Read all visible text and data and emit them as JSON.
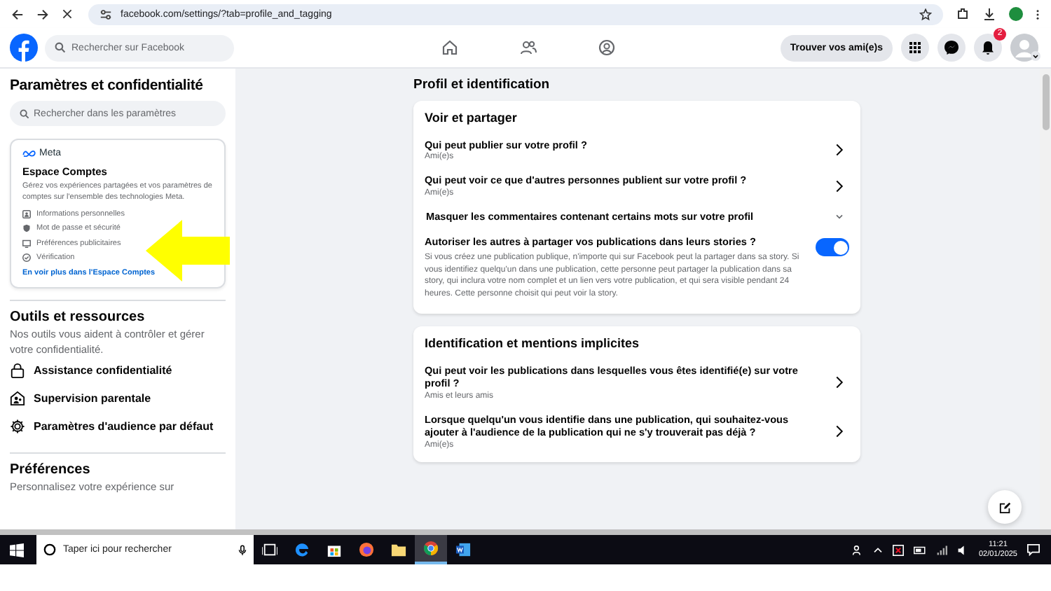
{
  "browser": {
    "url": "facebook.com/settings/?tab=profile_and_tagging"
  },
  "header": {
    "search_placeholder": "Rechercher sur Facebook",
    "find_friends": "Trouver vos ami(e)s",
    "notification_badge": "2"
  },
  "sidebar": {
    "title": "Paramètres et confidentialité",
    "search_placeholder": "Rechercher dans les paramètres",
    "accounts_center": {
      "brand": "Meta",
      "title": "Espace Comptes",
      "description": "Gérez vos expériences partagées et vos paramètres de comptes sur l'ensemble des technologies Meta.",
      "items": [
        {
          "kind": "person",
          "label": "Informations personnelles"
        },
        {
          "kind": "shield",
          "label": "Mot de passe et sécurité"
        },
        {
          "kind": "screen",
          "label": "Préférences publicitaires"
        },
        {
          "kind": "check",
          "label": "Vérification"
        }
      ],
      "link": "En voir plus dans l'Espace Comptes"
    },
    "tools": {
      "title": "Outils et ressources",
      "description": "Nos outils vous aident à contrôler et gérer votre confidentialité.",
      "items": [
        {
          "kind": "lock",
          "label": "Assistance confidentialité"
        },
        {
          "kind": "family",
          "label": "Supervision parentale"
        },
        {
          "kind": "gear",
          "label": "Paramètres d'audience par défaut"
        }
      ]
    },
    "preferences": {
      "title": "Préférences",
      "description": "Personnalisez votre expérience sur"
    }
  },
  "main": {
    "title": "Profil et identification",
    "sections": [
      {
        "title": "Voir et partager",
        "rows": [
          {
            "kind": "link",
            "label": "Qui peut publier sur votre profil ?",
            "value": "Ami(e)s"
          },
          {
            "kind": "link",
            "label": "Qui peut voir ce que d'autres personnes publient sur votre profil ?",
            "value": "Ami(e)s"
          },
          {
            "kind": "expand",
            "label": "Masquer les commentaires contenant certains mots sur votre profil",
            "expanded": false
          },
          {
            "kind": "toggle",
            "label": "Autoriser les autres à partager vos publications dans leurs stories ?",
            "description": "Si vous créez une publication publique, n'importe qui sur Facebook peut la partager dans sa story. Si vous identifiez quelqu'un dans une publication, cette personne peut partager la publication dans sa story, qui inclura votre nom complet et un lien vers votre publication, et qui sera visible pendant 24 heures. Cette personne choisit qui peut voir la story.",
            "on": true
          }
        ]
      },
      {
        "title": "Identification et mentions implicites",
        "rows": [
          {
            "kind": "link",
            "label": "Qui peut voir les publications dans lesquelles vous êtes identifié(e) sur votre profil ?",
            "value": "Amis et leurs amis"
          },
          {
            "kind": "link",
            "label": "Lorsque quelqu'un vous identifie dans une publication, qui souhaitez-vous ajouter à l'audience de la publication qui ne s'y trouverait pas déjà ?",
            "value": "Ami(e)s"
          }
        ]
      }
    ]
  },
  "taskbar": {
    "search_placeholder": "Taper ici pour rechercher",
    "time": "11:21",
    "date": "02/01/2025",
    "apps": [
      {
        "kind": "taskview",
        "selected": false
      },
      {
        "kind": "edge",
        "selected": false
      },
      {
        "kind": "store",
        "selected": false
      },
      {
        "kind": "firefox",
        "selected": false
      },
      {
        "kind": "folder",
        "selected": false
      },
      {
        "kind": "chrome",
        "selected": true
      },
      {
        "kind": "word",
        "selected": false
      }
    ]
  }
}
